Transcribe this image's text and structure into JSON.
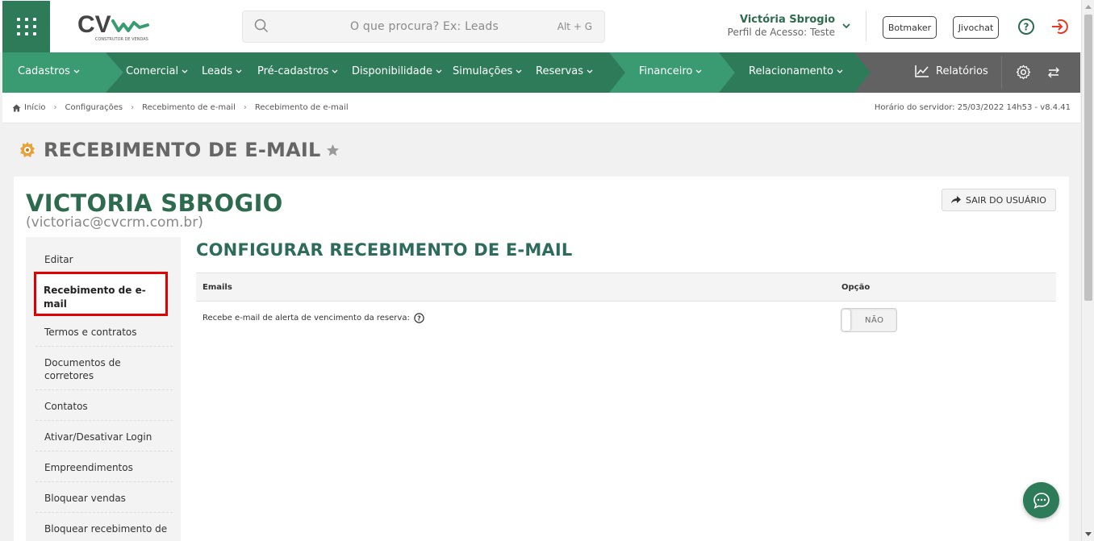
{
  "header": {
    "logo_text": "CVcrm",
    "logo_tagline": "CONSTRUTOR DE VENDAS",
    "search_placeholder": "O que procura? Ex: Leads",
    "search_shortcut": "Alt + G",
    "user_name": "Victória Sbrogio",
    "user_profile": "Perfil de Acesso: Teste",
    "btn_botmaker": "Botmaker",
    "btn_jivochat": "Jivochat"
  },
  "nav": {
    "items": [
      "Cadastros",
      "Comercial",
      "Leads",
      "Pré-cadastros",
      "Disponibilidade",
      "Simulações",
      "Reservas",
      "Financeiro",
      "Relacionamento"
    ],
    "reports": "Relatórios",
    "colors": {
      "green_primary": "#2e7b5a",
      "green_light": "#3a9b72",
      "gray": "#626262"
    }
  },
  "breadcrumb": {
    "items": [
      "Início",
      "Configurações",
      "Recebimento de e-mail",
      "Recebimento de e-mail"
    ],
    "server_time": "Horário do servidor: 25/03/2022 14h53 - v8.4.41"
  },
  "page": {
    "title": "RECEBIMENTO DE E-MAIL",
    "user_display_name": "VICTORIA SBROGIO",
    "user_email": "(victoriac@cvcrm.com.br)",
    "exit_user_label": "SAIR DO USUÁRIO",
    "section_title": "CONFIGURAR RECEBIMENTO DE E-MAIL"
  },
  "sidebar": {
    "items": [
      "Editar",
      "Recebimento de e-mail",
      "Termos e contratos",
      "Documentos de corretores",
      "Contatos",
      "Ativar/Desativar Login",
      "Empreendimentos",
      "Bloquear vendas",
      "Bloquear recebimento de"
    ],
    "active_index": 1
  },
  "table": {
    "headers": [
      "Emails",
      "Opção"
    ],
    "rows": [
      {
        "label": "Recebe e-mail de alerta de vencimento da reserva:",
        "toggle": "NÃO"
      }
    ]
  }
}
